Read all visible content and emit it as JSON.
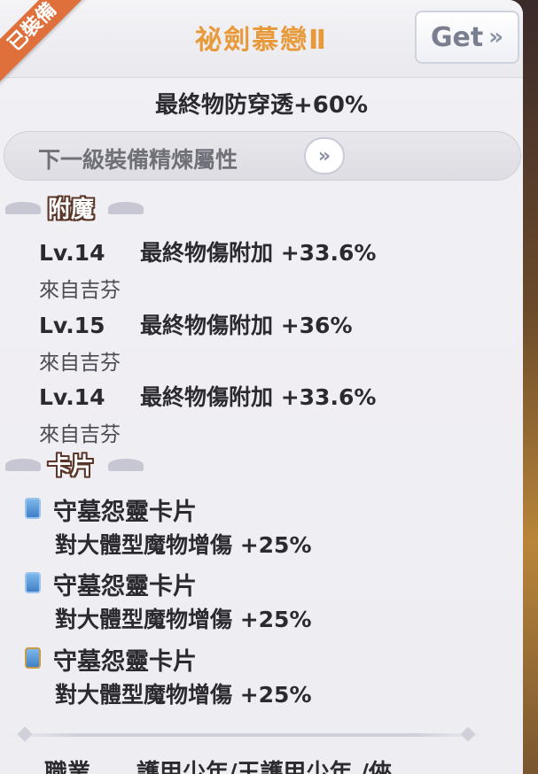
{
  "header": {
    "equipped_badge": "已裝備",
    "title": "祕劍慕戀Ⅱ",
    "get_button": "Get",
    "get_chevron": "»"
  },
  "main_stat": "最終物防穿透+60%",
  "refine": {
    "label": "下一級裝備精煉屬性",
    "button": "»"
  },
  "enchant_section": {
    "title": "附魔",
    "items": [
      {
        "level": "Lv.14",
        "effect": "最終物傷附加 +33.6%",
        "source": "來自吉芬"
      },
      {
        "level": "Lv.15",
        "effect": "最終物傷附加 +36%",
        "source": "來自吉芬"
      },
      {
        "level": "Lv.14",
        "effect": "最終物傷附加 +33.6%",
        "source": "來自吉芬"
      }
    ]
  },
  "card_section": {
    "title": "卡片",
    "items": [
      {
        "name": "守墓怨靈卡片",
        "effect": "對大體型魔物增傷 +25%"
      },
      {
        "name": "守墓怨靈卡片",
        "effect": "對大體型魔物增傷 +25%"
      },
      {
        "name": "守墓怨靈卡片",
        "effect": "對大體型魔物增傷 +25%"
      }
    ]
  },
  "footer_partial_text": "職業　　護甲少年/王護甲少年 /俠"
}
